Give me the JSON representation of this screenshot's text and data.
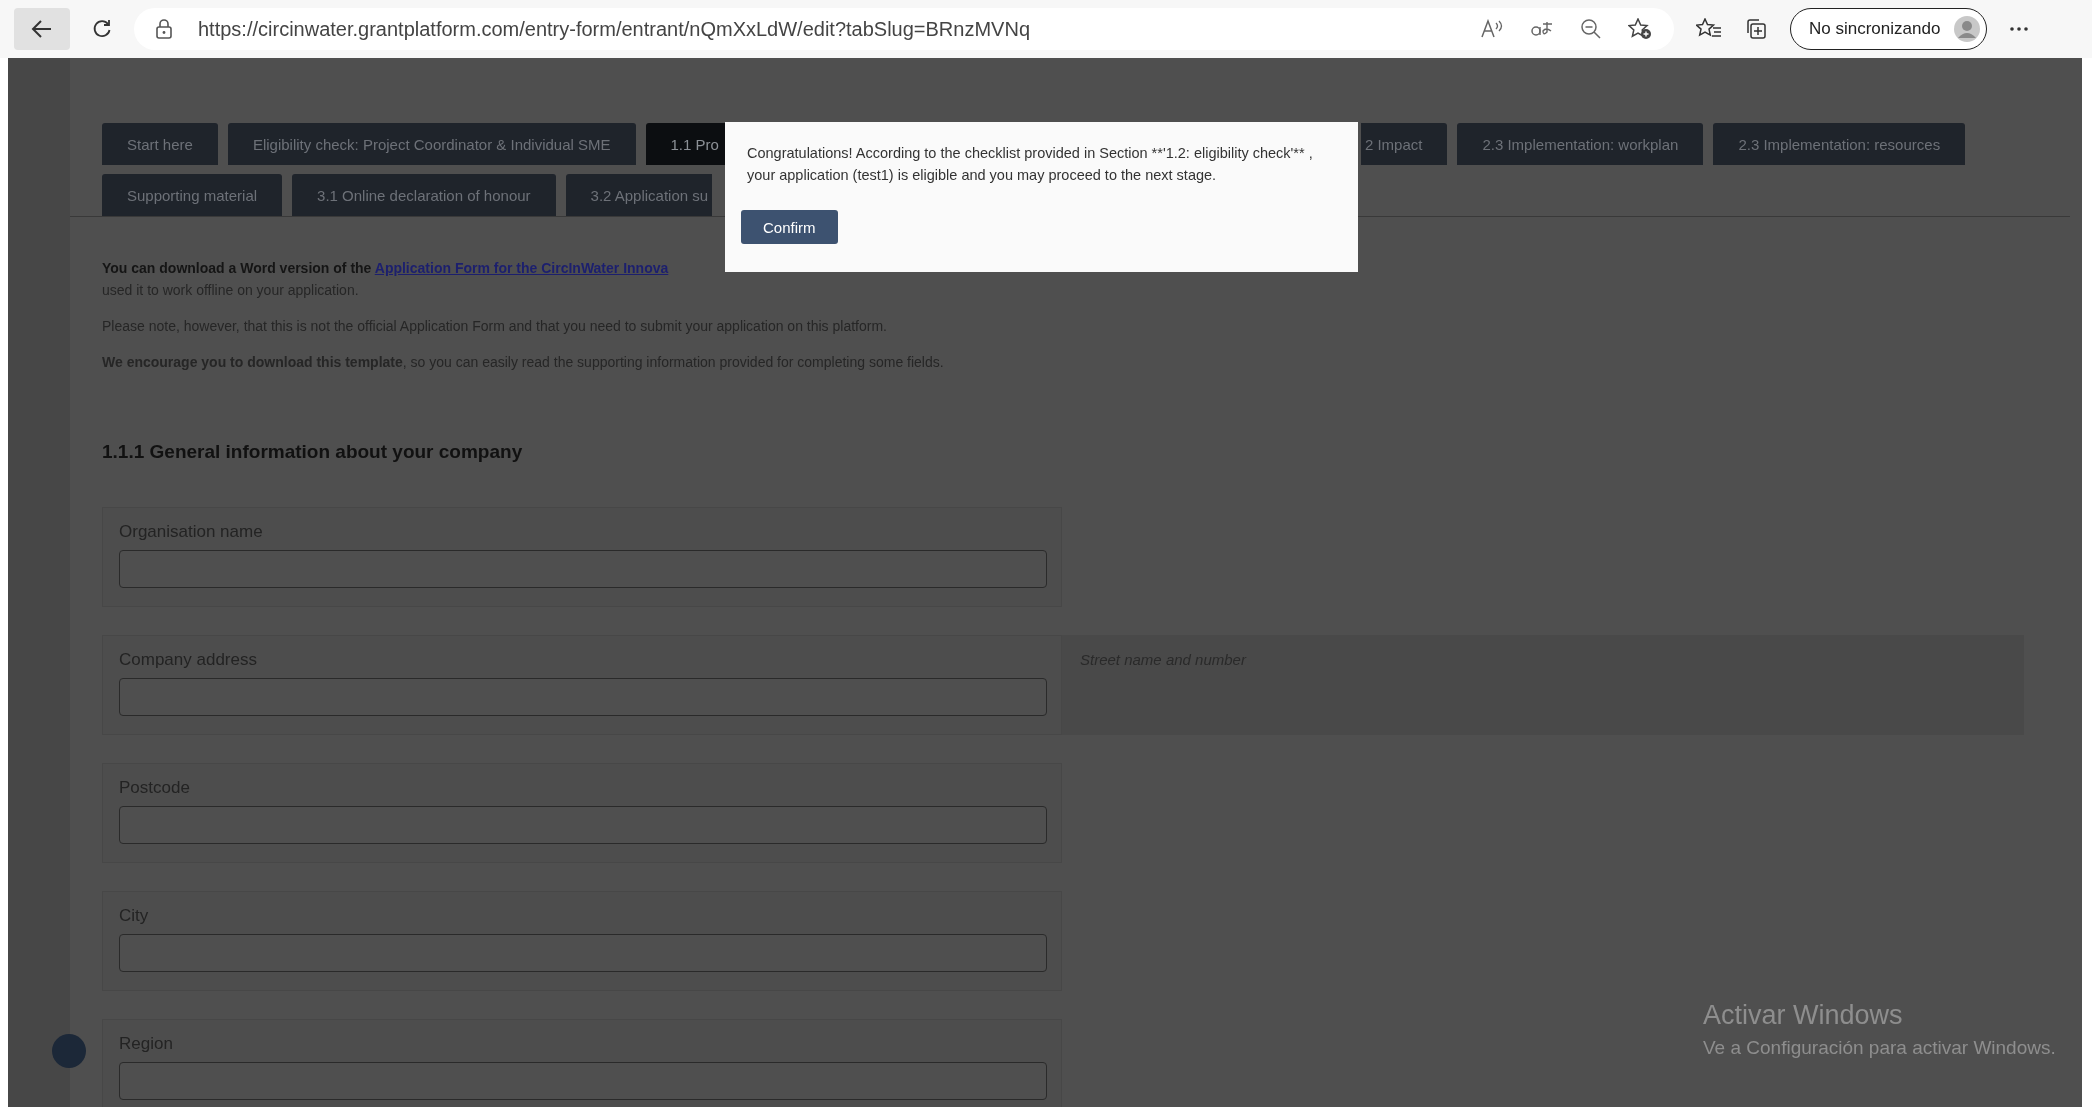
{
  "browser": {
    "url": "https://circinwater.grantplatform.com/entry-form/entrant/nQmXxLdW/edit?tabSlug=BRnzMVNq",
    "profile": "No sincronizando"
  },
  "tab_rows": [
    [
      {
        "label": "Start here",
        "selected": false
      },
      {
        "label": "Eligibility check: Project Coordinator & Individual SME",
        "selected": false
      },
      {
        "label": "1.1 Pro",
        "selected": true
      },
      {
        "label": "2 Impact",
        "selected": false
      },
      {
        "label": "2.3 Implementation: workplan",
        "selected": false
      },
      {
        "label": "2.3 Implementation: resources",
        "selected": false
      }
    ],
    [
      {
        "label": "Supporting material",
        "selected": false
      },
      {
        "label": "3.1 Online declaration of honour",
        "selected": false
      },
      {
        "label": "3.2 Application su",
        "selected": false
      }
    ]
  ],
  "intro": {
    "lead": "You can download a Word version of the ",
    "link": "Application Form for the CircInWater Innova",
    "tail": "used it to work offline on your application."
  },
  "notes": [
    "Please note, however, that this is not the official Application Form and that you need to submit your application on this platform.",
    "**We encourage you to download this template**, so you can easily read the supporting information provided for completing some fields."
  ],
  "section_title": "1.1.1 General information about your company",
  "fields": [
    {
      "label": "Organisation name"
    },
    {
      "label": "Company address",
      "help": "Street name and number"
    },
    {
      "label": "Postcode"
    },
    {
      "label": "City"
    },
    {
      "label": "Region"
    }
  ],
  "dialog": {
    "message": "Congratulations! According to the checklist provided in Section **'1.2: eligibility check'** , your application (test1) is eligible and you may proceed to the next stage.",
    "button": "Confirm"
  },
  "os_notice": {
    "title": "Activar Windows",
    "subtitle": "Ve a Configuración para activar Windows."
  }
}
